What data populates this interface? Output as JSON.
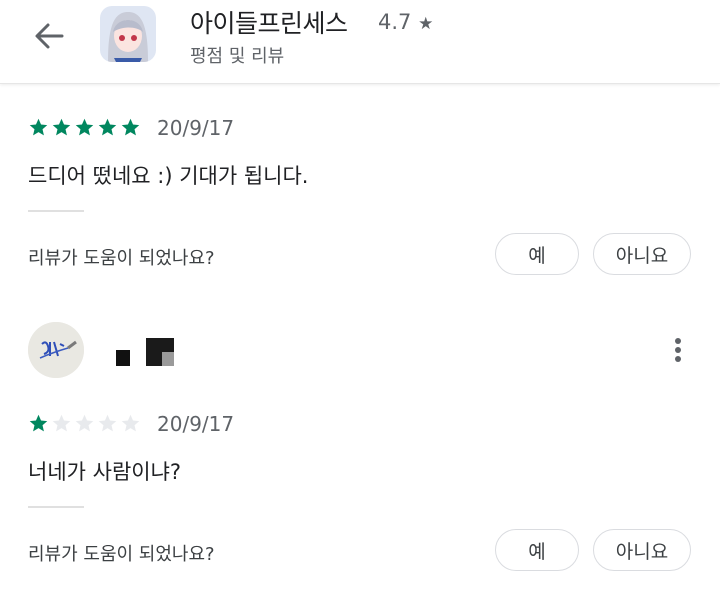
{
  "header": {
    "app_name": "아이들프린세스",
    "rating": "4.7",
    "rating_star": "★",
    "subtitle": "평점 및 리뷰",
    "back_icon": "arrow-left-icon"
  },
  "colors": {
    "star_filled": "#01875f",
    "star_empty": "#e8eaed",
    "text_primary": "#202124",
    "text_secondary": "#5f6368"
  },
  "reviews": [
    {
      "stars": 5,
      "date": "20/9/17",
      "text": "드디어 떴네요 :) 기대가 됩니다.",
      "helpful_question": "리뷰가 도움이 되었나요?",
      "yes_label": "예",
      "no_label": "아니요"
    },
    {
      "stars": 1,
      "date": "20/9/17",
      "text": "너네가 사람이냐?",
      "helpful_question": "리뷰가 도움이 되었나요?",
      "yes_label": "예",
      "no_label": "아니요",
      "more_icon": "more-vert-icon"
    }
  ]
}
